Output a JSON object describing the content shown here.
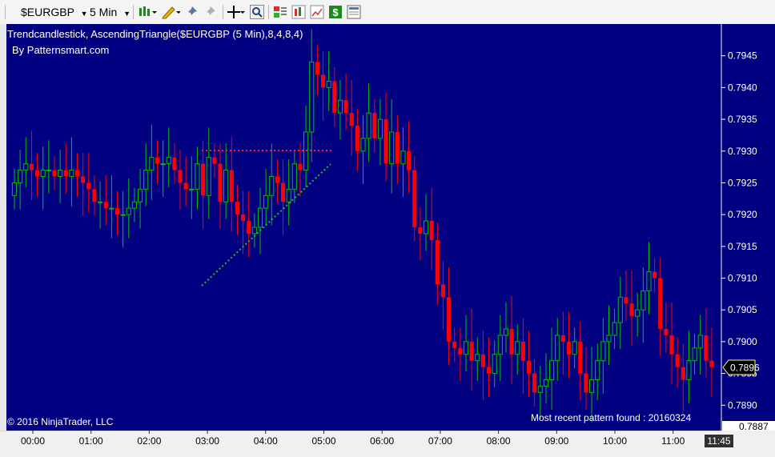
{
  "toolbar": {
    "instrument": "$EURGBP",
    "interval": "5 Min",
    "icons": [
      "bar-style-icon",
      "pencil-draw-icon",
      "pin-icon",
      "pin-disabled-icon",
      "crosshair-icon",
      "zoom-icon",
      "indicators-icon",
      "strategies-icon",
      "chart-props-icon",
      "dollar-icon",
      "panel-icon"
    ]
  },
  "chart": {
    "title": "Trendcandlestick,  AscendingTriangle($EURGBP (5 Min),8,4,8,4)",
    "subtitle": "By Patternsmart.com",
    "copyright": "© 2016 NinjaTrader, LLC",
    "pattern_note": "Most recent pattern found : 20160324",
    "last_price": "0.7896",
    "partial_price": "0.7887",
    "current_time": "11:45",
    "colors": {
      "background": "#000080",
      "up": "#00c000",
      "down": "#ff0000",
      "resistance": "#ff2020",
      "support": "#22c022"
    }
  },
  "chart_data": {
    "type": "candlestick",
    "y_ticks": [
      "0.7945",
      "0.7940",
      "0.7935",
      "0.7930",
      "0.7925",
      "0.7920",
      "0.7915",
      "0.7910",
      "0.7905",
      "0.7900",
      "0.7895",
      "0.7890"
    ],
    "x_ticks": [
      "00:00",
      "01:00",
      "02:00",
      "03:00",
      "04:00",
      "05:00",
      "06:00",
      "07:00",
      "08:00",
      "09:00",
      "10:00",
      "11:00"
    ],
    "ylim": [
      0.7886,
      0.795
    ],
    "close_path": [
      0.7925,
      0.7927,
      0.7928,
      0.7927,
      0.7926,
      0.7927,
      0.7927,
      0.7926,
      0.7927,
      0.7926,
      0.7927,
      0.7926,
      0.7925,
      0.7924,
      0.7922,
      0.7922,
      0.7921,
      0.7921,
      0.792,
      0.792,
      0.7921,
      0.7922,
      0.7924,
      0.7927,
      0.7929,
      0.7928,
      0.7928,
      0.7929,
      0.7927,
      0.7925,
      0.7924,
      0.7924,
      0.7928,
      0.7923,
      0.7929,
      0.7928,
      0.7922,
      0.7927,
      0.7922,
      0.792,
      0.7919,
      0.7917,
      0.7918,
      0.7921,
      0.7923,
      0.7926,
      0.7925,
      0.7922,
      0.7924,
      0.7928,
      0.7927,
      0.7933,
      0.7944,
      0.7942,
      0.794,
      0.7941,
      0.7936,
      0.7938,
      0.7936,
      0.7934,
      0.793,
      0.7932,
      0.7936,
      0.7932,
      0.7935,
      0.7928,
      0.7933,
      0.7928,
      0.793,
      0.7927,
      0.7918,
      0.7917,
      0.7919,
      0.7916,
      0.7909,
      0.7907,
      0.79,
      0.7899,
      0.7898,
      0.79,
      0.7897,
      0.7898,
      0.7896,
      0.7895,
      0.7898,
      0.7901,
      0.7902,
      0.7898,
      0.79,
      0.7897,
      0.7895,
      0.7892,
      0.7893,
      0.7894,
      0.7897,
      0.7901,
      0.79,
      0.7898,
      0.79,
      0.7895,
      0.7892,
      0.7894,
      0.7897,
      0.79,
      0.7901,
      0.7903,
      0.7907,
      0.7906,
      0.7904,
      0.7905,
      0.7908,
      0.7911,
      0.791,
      0.7902,
      0.7901,
      0.7898,
      0.7896,
      0.7894,
      0.7897,
      0.7899,
      0.7901,
      0.7897,
      0.7896
    ]
  }
}
